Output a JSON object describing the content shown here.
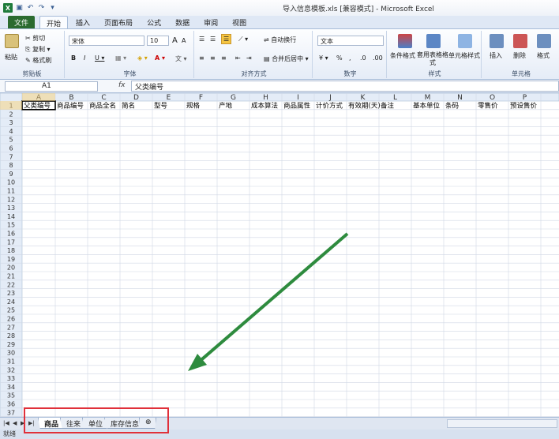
{
  "window": {
    "title": "导入信息模板.xls [兼容模式] - Microsoft Excel"
  },
  "ribbon_tabs": [
    "文件",
    "开始",
    "插入",
    "页面布局",
    "公式",
    "数据",
    "审阅",
    "视图"
  ],
  "ribbon": {
    "clipboard": {
      "paste": "粘贴",
      "cut": "剪切",
      "copy": "复制 ▾",
      "format_painter": "格式刷",
      "label": "剪贴板"
    },
    "font": {
      "name": "宋体",
      "size": "10",
      "bold": "B",
      "italic": "I",
      "underline": "U ▾",
      "grow": "A",
      "shrink": "A",
      "label": "字体"
    },
    "alignment": {
      "wrap": "自动换行",
      "merge": "合并后居中 ▾",
      "label": "对齐方式"
    },
    "number": {
      "format": "文本",
      "percent": "%",
      "comma": ",",
      "label": "数字"
    },
    "styles": {
      "conditional": "条件格式",
      "table": "套用表格格式",
      "cell": "单元格样式",
      "label": "样式"
    },
    "cells": {
      "insert": "插入",
      "delete": "删除",
      "format": "格式",
      "label": "单元格"
    }
  },
  "formula_bar": {
    "name_box": "A1",
    "fx": "fx",
    "value": "父类编号"
  },
  "columns": [
    "A",
    "B",
    "C",
    "D",
    "E",
    "F",
    "G",
    "H",
    "I",
    "J",
    "K",
    "L",
    "M",
    "N",
    "O",
    "P"
  ],
  "headers": [
    "父类编号",
    "商品编号",
    "商品全名",
    "简名",
    "型号",
    "规格",
    "产地",
    "成本算法",
    "商品属性",
    "计价方式",
    "有效期(天)",
    "备注",
    "基本单位",
    "条码",
    "零售价",
    "预设售价"
  ],
  "row_count": 37,
  "sheets": [
    {
      "name": "商品"
    },
    {
      "name": "往来"
    },
    {
      "name": "单位"
    },
    {
      "name": "库存信息"
    }
  ],
  "status": "就绪",
  "colors": {
    "arrow": "#2e8b3e",
    "highlight": "#e0303a",
    "file_tab": "#2b6b2f"
  }
}
